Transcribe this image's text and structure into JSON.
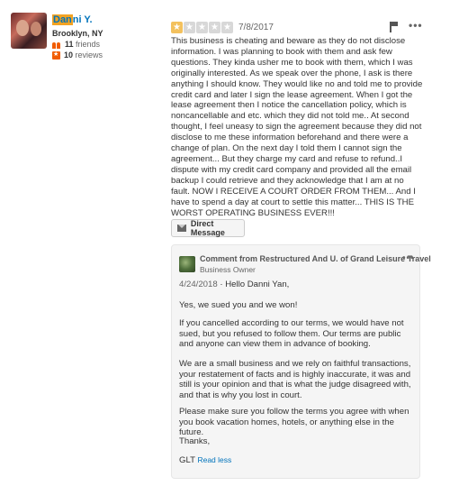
{
  "user": {
    "name_highlight": "Dan",
    "name_rest": "ni Y.",
    "location": "Brooklyn, NY",
    "friends_count": "11",
    "friends_label": "friends",
    "reviews_count": "10",
    "reviews_label": "reviews"
  },
  "review": {
    "rating": 1,
    "max_rating": 5,
    "date": "7/8/2017",
    "text": "This business is cheating and beware as they do not disclose information. I was planning to book with them and ask few questions. They kinda usher me to book with them, which I was originally interested. As we speak over the phone, I ask is there anything I should know. They would like no and told me to provide credit card and later I sign the lease agreement. When I got the lease agreement then I notice the cancellation policy, which is noncancellable and etc. which they did not told me.. At second thought, I feel uneasy to sign the agreement because they did not disclose to me these information beforehand and there were a change of plan. On the next day I told them I cannot sign the agreement... But they charge my card and refuse to refund..I dispute with my credit card company and provided all the email backup I could retrieve and they acknowledge that I am at no fault. NOW I RECEIVE A COURT ORDER FROM THEM... And I have to spend a day at court to settle this matter... THIS IS THE WORST OPERATING BUSINESS EVER!!!"
  },
  "direct_message": {
    "label": "Direct Message"
  },
  "comment": {
    "from": "Comment from Restructured And U. of Grand Leisure Travel",
    "role": "Business Owner",
    "date": "4/24/2018",
    "greeting": "Hello Danni Yan,",
    "p1": "Yes, we sued you and we won!",
    "p2": "If you cancelled according to our terms, we would have not sued, but you refused to follow them. Our terms are public and anyone can view them in advance of booking.",
    "p3": "We are a small business and we rely on faithful transactions, your restatement of facts and is highly inaccurate, it was and still is your opinion and that is what the judge disagreed with, and that is why you lost in court.",
    "p4": "Please make sure you follow the terms you agree with when you book vacation homes, hotels, or anything else in the future.",
    "p5": "Thanks,",
    "signature": "GLT",
    "read_less": "Read less"
  },
  "colors": {
    "link": "#0073bb",
    "highlight": "#f3a323",
    "star_on": "#f3c15e",
    "star_off": "#d8d8d8",
    "accent": "#f15c00"
  },
  "icons": [
    "avatar",
    "friends-icon",
    "review-icon",
    "star-icon",
    "flag-icon",
    "more-icon",
    "envelope-icon",
    "business-avatar"
  ]
}
